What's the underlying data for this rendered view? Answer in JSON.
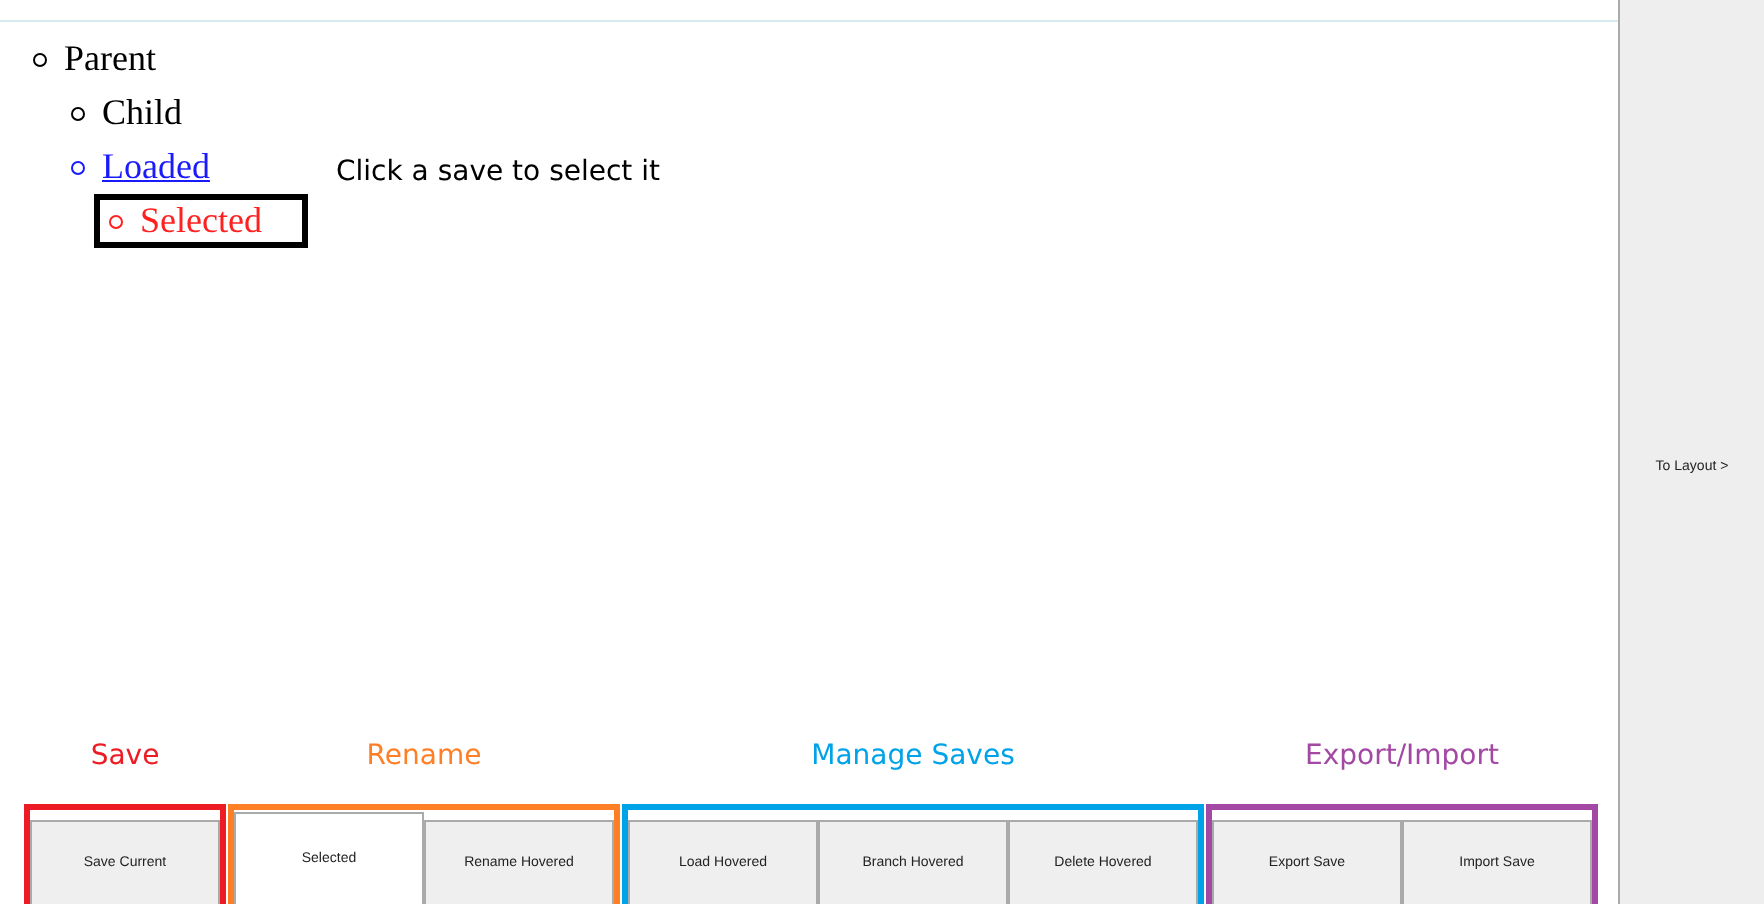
{
  "tree": [
    {
      "label": "Parent",
      "loaded": false,
      "selected": false,
      "children": [
        {
          "label": "Child",
          "loaded": false,
          "selected": false
        },
        {
          "label": "Loaded",
          "loaded": true,
          "selected": false,
          "children": [
            {
              "label": "Selected",
              "loaded": false,
              "selected": true
            }
          ]
        }
      ]
    }
  ],
  "hint": "Click a save to select it",
  "groups": [
    {
      "label": "Save",
      "color": "#ed1c24",
      "buttons": [
        {
          "label": "Save Current",
          "selected": false
        }
      ]
    },
    {
      "label": "Rename",
      "color": "#ff7f27",
      "buttons": [
        {
          "label": "Selected",
          "selected": true
        },
        {
          "label": "Rename Hovered",
          "selected": false
        }
      ]
    },
    {
      "label": "Manage Saves",
      "color": "#00a2e8",
      "buttons": [
        {
          "label": "Load Hovered",
          "selected": false
        },
        {
          "label": "Branch Hovered",
          "selected": false
        },
        {
          "label": "Delete Hovered",
          "selected": false
        }
      ]
    },
    {
      "label": "Export/Import",
      "color": "#a349a4",
      "buttons": [
        {
          "label": "Export Save",
          "selected": false
        },
        {
          "label": "Import Save",
          "selected": false
        }
      ]
    }
  ],
  "side_button": "To Layout >"
}
